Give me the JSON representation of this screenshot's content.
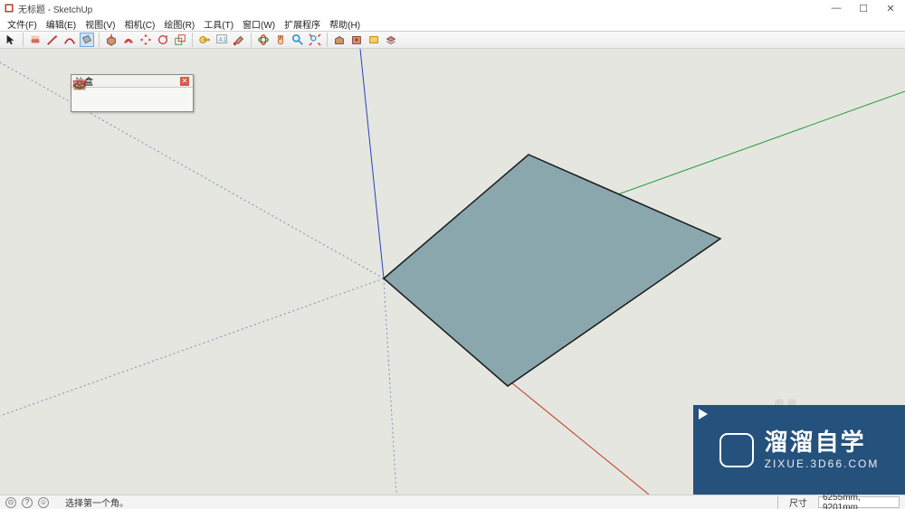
{
  "window": {
    "title": "无标题 - SketchUp",
    "minimize": "—",
    "maximize": "☐",
    "close": "✕"
  },
  "menu": {
    "items": [
      "文件(F)",
      "编辑(E)",
      "视图(V)",
      "相机(C)",
      "绘图(R)",
      "工具(T)",
      "窗口(W)",
      "扩展程序",
      "帮助(H)"
    ]
  },
  "toolbar": {
    "tools": [
      {
        "name": "select-tool",
        "icon": "cursor"
      },
      {
        "name": "eraser-tool",
        "icon": "eraser"
      },
      {
        "name": "line-tool",
        "icon": "pencil"
      },
      {
        "name": "arc-tool",
        "icon": "arc"
      },
      {
        "name": "rectangle-tool",
        "icon": "rect",
        "active": true
      },
      {
        "name": "pushpull-tool",
        "icon": "pushpull"
      },
      {
        "name": "offset-tool",
        "icon": "offset"
      },
      {
        "name": "move-tool",
        "icon": "move"
      },
      {
        "name": "rotate-tool",
        "icon": "rotate"
      },
      {
        "name": "scale-tool",
        "icon": "scale"
      },
      {
        "name": "tape-tool",
        "icon": "tape"
      },
      {
        "name": "text-tool",
        "icon": "text"
      },
      {
        "name": "paint-tool",
        "icon": "bucket"
      },
      {
        "name": "orbit-tool",
        "icon": "orbit"
      },
      {
        "name": "pan-tool",
        "icon": "hand"
      },
      {
        "name": "zoom-tool",
        "icon": "zoom"
      },
      {
        "name": "zoomext-tool",
        "icon": "zoomext"
      },
      {
        "name": "warehouse-tool",
        "icon": "box1"
      },
      {
        "name": "extwarehouse-tool",
        "icon": "box2"
      },
      {
        "name": "layers-tool",
        "icon": "layers"
      },
      {
        "name": "outliner-tool",
        "icon": "outline"
      }
    ]
  },
  "panel": {
    "title": "沙盒",
    "tools": [
      {
        "name": "sandbox-fromcontours",
        "icon": "s1"
      },
      {
        "name": "sandbox-fromscratch",
        "icon": "s2"
      },
      {
        "name": "sandbox-smoove",
        "icon": "s3"
      },
      {
        "name": "sandbox-stamp",
        "icon": "s4"
      },
      {
        "name": "sandbox-drape",
        "icon": "s5"
      },
      {
        "name": "sandbox-adddetail",
        "icon": "s6"
      }
    ]
  },
  "axes": {
    "colors": {
      "x_pos": "#c03b2b",
      "x_neg": "#7a90bb",
      "y_pos": "#2a9d3e",
      "y_neg": "#7a90bb",
      "z_pos": "#2b40c0",
      "z_neg": "#7a90bb"
    }
  },
  "shape": {
    "fill": "#8aa7ad",
    "stroke": "#1a1a1a"
  },
  "statusbar": {
    "hint": "选择第一个角。",
    "dim_label": "尺寸",
    "dim_value": "6255mm, 9201mm"
  },
  "watermark": {
    "line1": "溜溜自学",
    "line2": "ZIXUE.3D66.COM"
  }
}
